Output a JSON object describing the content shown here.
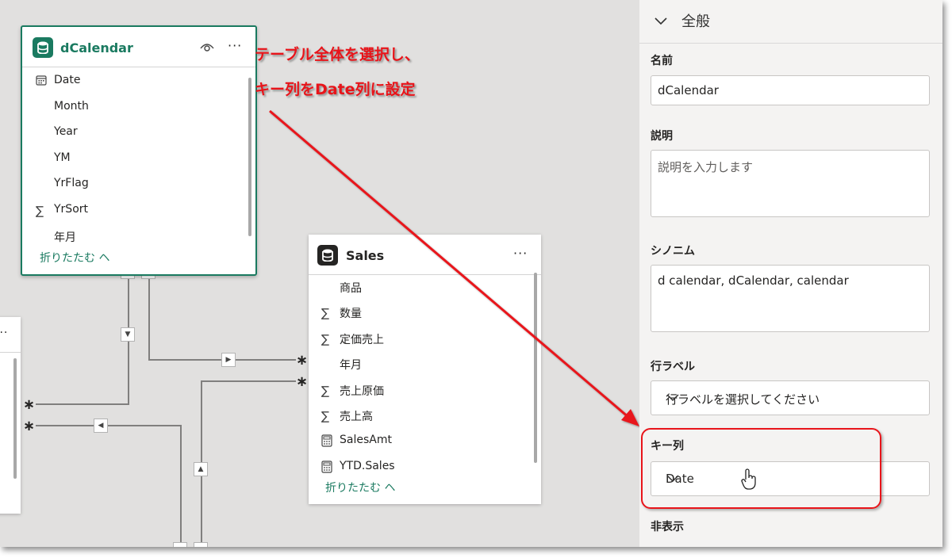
{
  "annotation": {
    "line1": "テーブル全体を選択し、",
    "line2": "キー列をDate列に設定"
  },
  "dcalendar": {
    "title": "dCalendar",
    "fields": [
      {
        "icon": "calendar-icon",
        "label": "Date"
      },
      {
        "icon": "",
        "label": "Month"
      },
      {
        "icon": "",
        "label": "Year"
      },
      {
        "icon": "",
        "label": "YM"
      },
      {
        "icon": "",
        "label": "YrFlag"
      },
      {
        "icon": "sigma-icon",
        "label": "YrSort"
      },
      {
        "icon": "",
        "label": "年月"
      }
    ],
    "collapse_label": "折りたたむ ヘ"
  },
  "sales": {
    "title": "Sales",
    "fields": [
      {
        "icon": "",
        "label": "商品"
      },
      {
        "icon": "sigma-icon",
        "label": "数量"
      },
      {
        "icon": "sigma-icon",
        "label": "定価売上"
      },
      {
        "icon": "",
        "label": "年月"
      },
      {
        "icon": "sigma-icon",
        "label": "売上原価"
      },
      {
        "icon": "sigma-icon",
        "label": "売上高"
      },
      {
        "icon": "calculator-icon",
        "label": "SalesAmt"
      },
      {
        "icon": "calculator-icon",
        "label": "YTD.Sales"
      }
    ],
    "collapse_label": "折りたたむ ヘ"
  },
  "left_card": {
    "more": "···"
  },
  "relationships": {
    "many_symbol": "∗"
  },
  "panel": {
    "section_title": "全般",
    "name_label": "名前",
    "name_value": "dCalendar",
    "description_label": "説明",
    "description_placeholder": "説明を入力します",
    "synonyms_label": "シノニム",
    "synonyms_value": "d calendar, dCalendar, calendar",
    "row_label_label": "行ラベル",
    "row_label_placeholder": "行ラベルを選択してください",
    "key_column_label": "キー列",
    "key_column_value": "Date",
    "hidden_label": "非表示"
  },
  "colors": {
    "accent": "#1a7a60",
    "annotation_red": "#e8141a",
    "canvas_bg": "#e1e0df",
    "panel_bg": "#f4f3f2"
  }
}
